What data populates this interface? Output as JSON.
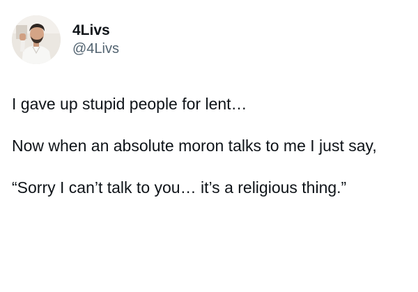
{
  "author": {
    "display_name": "4Livs",
    "handle": "@4Livs",
    "avatar_icon": "profile-photo-avatar"
  },
  "tweet": {
    "paragraphs": [
      "I gave up stupid people for lent…",
      "Now when an absolute moron talks to me I just say,",
      "“Sorry I can’t talk to you… it’s a religious thing.”"
    ]
  },
  "colors": {
    "text": "#0f1419",
    "secondary_text": "#536471",
    "background": "#ffffff"
  }
}
